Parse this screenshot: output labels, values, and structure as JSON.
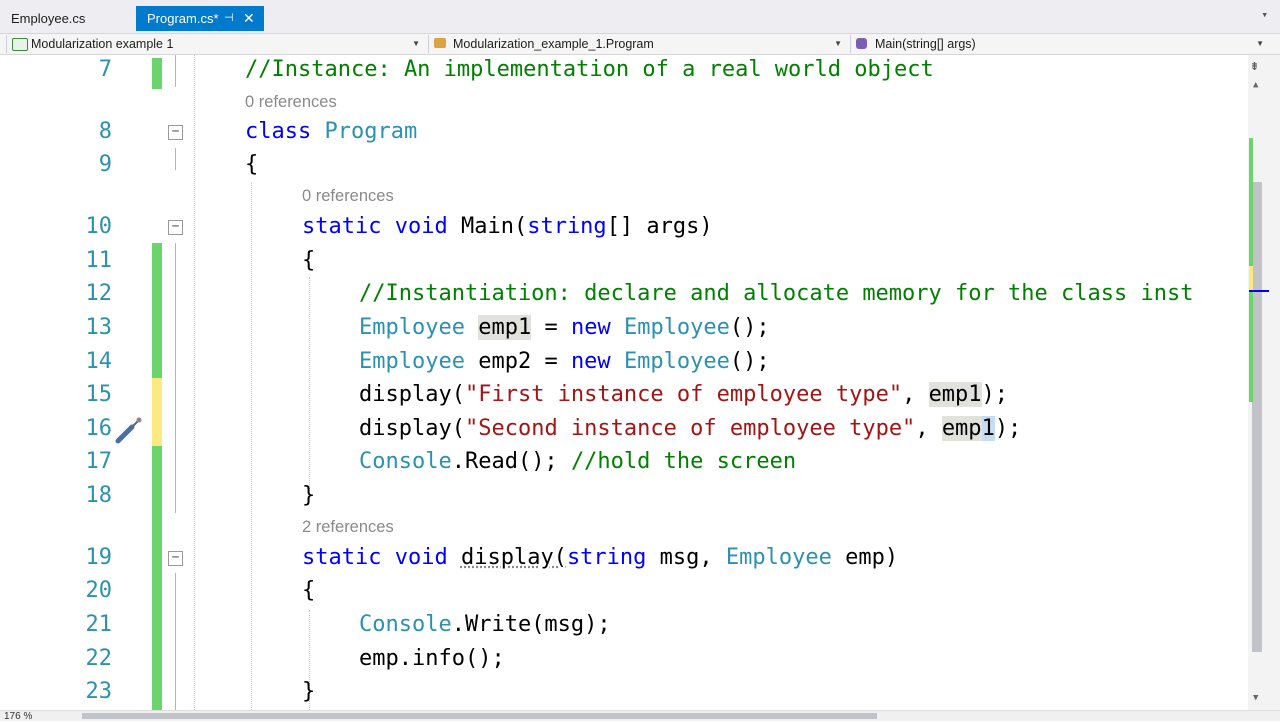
{
  "tabs": [
    {
      "label": "Employee.cs",
      "active": false
    },
    {
      "label": "Program.cs*",
      "active": true
    }
  ],
  "tab_pin_glyph": "⊣",
  "tab_close_glyph": "✕",
  "tab_dropdown_glyph": "▾",
  "navbar": {
    "project": "Modularization example 1",
    "class": "Modularization_example_1.Program",
    "member": "Main(string[] args)"
  },
  "zoom_level": "176 %",
  "colors": {
    "keyword": "#0000ff",
    "type": "#2b91af",
    "comment": "#008000",
    "string": "#a31515",
    "tab_active": "#007acc",
    "changed_saved": "#6cd46c",
    "changed_unsaved": "#fde981"
  },
  "editor": {
    "line_numbers": [
      "7",
      "8",
      "9",
      "10",
      "11",
      "12",
      "13",
      "14",
      "15",
      "16",
      "17",
      "18",
      "19",
      "20",
      "21",
      "22",
      "23"
    ],
    "ref_labels": [
      "0 references",
      "0 references",
      "2 references"
    ],
    "lines": {
      "l7": {
        "comment": "//Instance: An implementation of a real world object"
      },
      "l8": {
        "kw": "class",
        "type": "Program"
      },
      "l9": {
        "text": "{"
      },
      "l10": {
        "kw1": "static",
        "kw2": "void",
        "name": "Main(",
        "kw3": "string",
        "rest": "[] args)"
      },
      "l11": {
        "text": "{"
      },
      "l12": {
        "comment": "//Instantiation: declare and allocate memory for the class inst"
      },
      "l13": {
        "type1": "Employee",
        "var": "emp1",
        "eq": " = ",
        "kw": "new",
        "type2": "Employee",
        "end": "();"
      },
      "l14": {
        "type1": "Employee",
        "rest": " emp2 = ",
        "kw": "new",
        "type2": "Employee",
        "end": "();"
      },
      "l15": {
        "fn": "display(",
        "str": "\"First instance of employee type\"",
        "sep": ", ",
        "arg": "emp1",
        "end": ");"
      },
      "l16": {
        "fn": "display(",
        "str": "\"Second instance of employee type\"",
        "sep": ", ",
        "arg_a": "emp",
        "arg_b": "1",
        "end": ");"
      },
      "l17": {
        "type": "Console",
        "call": ".Read(); ",
        "comment": "//hold the screen"
      },
      "l18": {
        "text": "}"
      },
      "l19": {
        "kw1": "static",
        "kw2": "void",
        "name": "display(",
        "kw3": "string",
        "mid": " msg, ",
        "type": "Employee",
        "end": " emp)"
      },
      "l20": {
        "text": "{"
      },
      "l21": {
        "type": "Console",
        "rest": ".Write(msg);"
      },
      "l22": {
        "text": "emp.info();"
      },
      "l23": {
        "text": "}"
      }
    }
  }
}
